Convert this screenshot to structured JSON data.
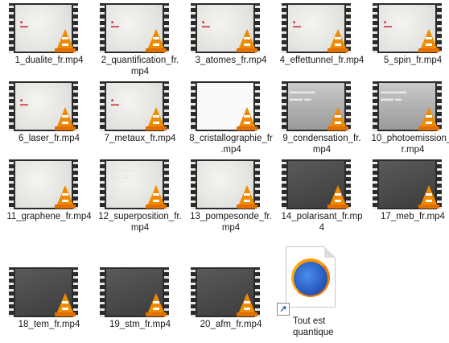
{
  "files": [
    {
      "name": "1_dualite_fr.mp4",
      "style": "light",
      "overlay": "red"
    },
    {
      "name": "2_quantification_fr.mp4",
      "style": "light",
      "overlay": "red"
    },
    {
      "name": "3_atomes_fr.mp4",
      "style": "light",
      "overlay": "red"
    },
    {
      "name": "4_effettunnel_fr.mp4",
      "style": "light",
      "overlay": "red"
    },
    {
      "name": "5_spin_fr.mp4",
      "style": "light",
      "overlay": "red"
    },
    {
      "name": "6_laser_fr.mp4",
      "style": "light",
      "overlay": "red"
    },
    {
      "name": "7_metaux_fr.mp4",
      "style": "light",
      "overlay": "red"
    },
    {
      "name": "8_cristallographie_fr.mp4",
      "style": "blank",
      "overlay": "none"
    },
    {
      "name": "9_condensation_fr.mp4",
      "style": "grid",
      "overlay": "white"
    },
    {
      "name": "10_photoemission_fr.mp4",
      "style": "grid",
      "overlay": "white"
    },
    {
      "name": "11_graphene_fr.mp4",
      "style": "light",
      "overlay": "none"
    },
    {
      "name": "12_superposition_fr.mp4",
      "style": "light",
      "overlay": "white"
    },
    {
      "name": "13_pompesonde_fr.mp4",
      "style": "light",
      "overlay": "none"
    },
    {
      "name": "14_polarisant_fr.mp4",
      "style": "dark",
      "overlay": "none"
    },
    {
      "name": "17_meb_fr.mp4",
      "style": "dark",
      "overlay": "none"
    },
    {
      "name": "18_tem_fr.mp4",
      "style": "dark",
      "overlay": "none"
    },
    {
      "name": "19_stm_fr.mp4",
      "style": "dark",
      "overlay": "none"
    },
    {
      "name": "20_afm_fr.mp4",
      "style": "dark",
      "overlay": "none"
    }
  ],
  "shortcut": {
    "name": "Tout est quantique",
    "icon": "firefox-icon"
  },
  "colors": {
    "vlc_orange": "#f08a00",
    "accent_red": "#c8242c"
  }
}
